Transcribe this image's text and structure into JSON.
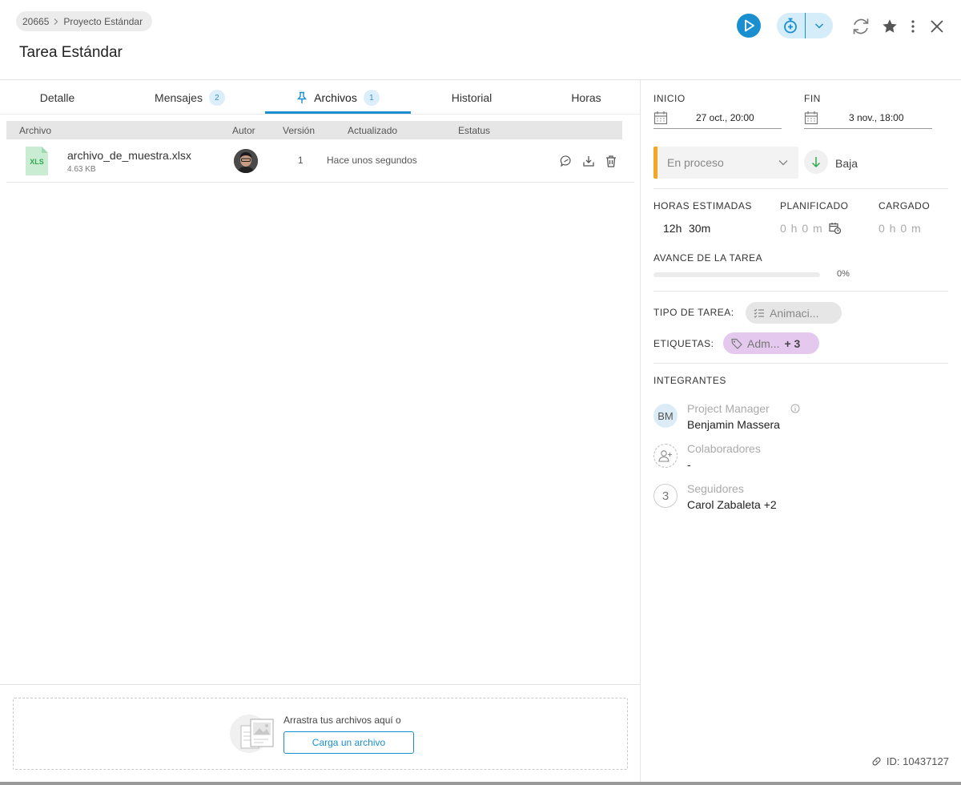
{
  "breadcrumb": {
    "project_id": "20665",
    "project_name": "Proyecto Estándar"
  },
  "page_title": "Tarea Estándar",
  "tabs": [
    {
      "label": "Detalle"
    },
    {
      "label": "Mensajes",
      "badge": "2"
    },
    {
      "label": "Archivos",
      "badge": "1",
      "active": true
    },
    {
      "label": "Historial"
    },
    {
      "label": "Horas"
    }
  ],
  "files_table": {
    "headers": {
      "file": "Archivo",
      "author": "Autor",
      "version": "Versión",
      "updated": "Actualizado",
      "status": "Estatus"
    },
    "rows": [
      {
        "icon_text": "XLS",
        "name": "archivo_de_muestra.xlsx",
        "size": "4.63 KB",
        "version": "1",
        "updated": "Hace unos segundos"
      }
    ]
  },
  "upload": {
    "prompt": "Arrastra tus archivos aquí o",
    "button_label": "Carga un archivo"
  },
  "dates": {
    "start_label": "INICIO",
    "start_value": "27 oct., 20:00",
    "end_label": "FIN",
    "end_value": "3 nov., 18:00"
  },
  "status": {
    "value": "En proceso",
    "priority": "Baja"
  },
  "hours": {
    "estimated_label": "HORAS ESTIMADAS",
    "estimated_h": "12h",
    "estimated_m": "30m",
    "planned_label": "PLANIFICADO",
    "planned_value": "0 h 0 m",
    "loaded_label": "CARGADO",
    "loaded_value": "0 h 0 m"
  },
  "progress": {
    "label": "AVANCE DE LA TAREA",
    "value_text": "0%",
    "percent": 0
  },
  "task_type": {
    "label": "TIPO DE TAREA:",
    "value": "Animaci..."
  },
  "tags": {
    "label": "ETIQUETAS:",
    "value": "Adm...",
    "more": "+ 3"
  },
  "members": {
    "label": "INTEGRANTES",
    "pm": {
      "initials": "BM",
      "role": "Project Manager",
      "name": "Benjamin Massera"
    },
    "collaborators": {
      "role": "Colaboradores",
      "name": "-"
    },
    "followers": {
      "count": "3",
      "role": "Seguidores",
      "name": "Carol Zabaleta +2"
    }
  },
  "task_id": "ID: 10437127",
  "colors": {
    "accent": "#1a8fd0",
    "status": "#f5a623",
    "tag": "#e4c8ee"
  }
}
